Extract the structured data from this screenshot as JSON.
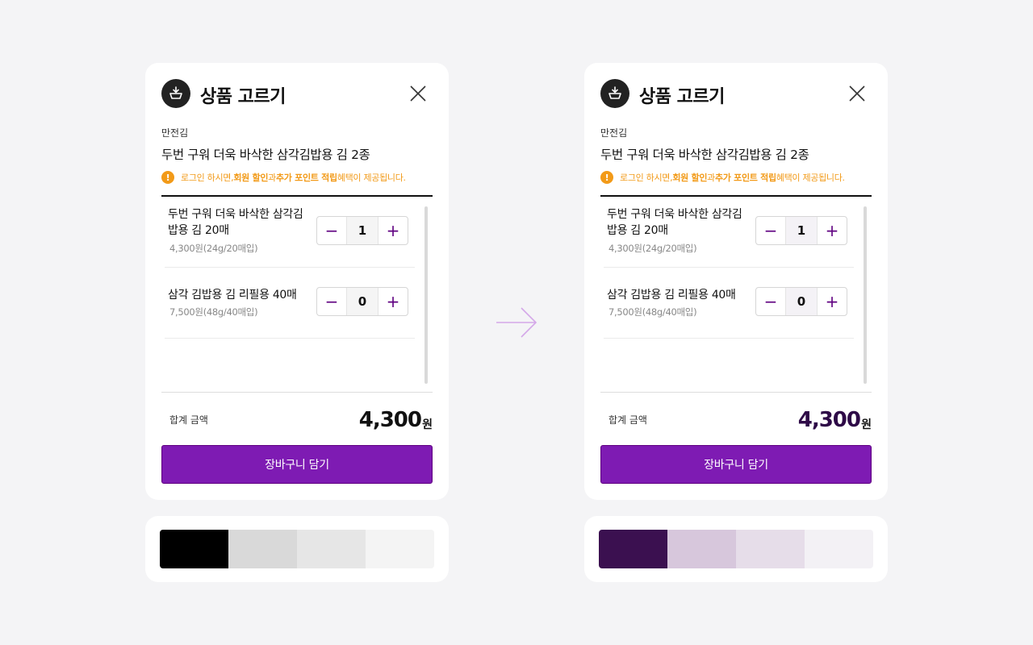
{
  "panels": [
    {
      "title": "상품 고르기",
      "brand": "만전김",
      "product_name": "두번 구워 더욱 바삭한 삼각김밥용  김 2종",
      "notice": {
        "prefix": "로그인 하시면, ",
        "highlight1": "회원 할인",
        "mid": "과 ",
        "highlight2": "추가 포인트 적립",
        "suffix": " 혜택이 제공됩니다."
      },
      "items": [
        {
          "name": "두번 구워 더욱 바삭한 삼각김밥용 김 20매",
          "price": "4,300원(24g/20매입)",
          "qty": "1"
        },
        {
          "name": "삼각 김밥용 김 리필용 40매",
          "price": "7,500원(48g/40매입)",
          "qty": "0"
        }
      ],
      "total_label": "합계 금액",
      "total_amount": "4,300",
      "total_unit": "원",
      "cart_button": "장바구니 담기",
      "amount_color": "#111111",
      "palette": [
        "#000000",
        "#d9d9d9",
        "#e6e6e6",
        "#f4f4f4"
      ]
    },
    {
      "title": "상품 고르기",
      "brand": "만전김",
      "product_name": "두번 구워 더욱 바삭한 삼각김밥용  김 2종",
      "notice": {
        "prefix": "로그인 하시면, ",
        "highlight1": "회원 할인",
        "mid": "과 ",
        "highlight2": "추가 포인트 적립",
        "suffix": " 혜택이 제공됩니다."
      },
      "items": [
        {
          "name": "두번 구워 더욱 바삭한 삼각김밥용 김 20매",
          "price": "4,300원(24g/20매입)",
          "qty": "1"
        },
        {
          "name": "삼각 김밥용 김 리필용 40매",
          "price": "7,500원(48g/40매입)",
          "qty": "0"
        }
      ],
      "total_label": "합계 금액",
      "total_amount": "4,300",
      "total_unit": "원",
      "cart_button": "장바구니 담기",
      "amount_color": "#2e0a47",
      "palette": [
        "#3b1050",
        "#d7c7dc",
        "#e6dde9",
        "#f3f1f5"
      ]
    }
  ],
  "colors": {
    "accent": "#7e1bb3",
    "accent_dark": "#5f0080",
    "notice": "#f29a18",
    "background": "#f4f4f6",
    "arrow": "#d4a8e8"
  },
  "icons": {
    "logo": "basket-arrow-icon",
    "close": "close-icon",
    "info": "info-icon",
    "minus": "minus-icon",
    "plus": "plus-icon",
    "transition": "arrow-right-icon"
  }
}
